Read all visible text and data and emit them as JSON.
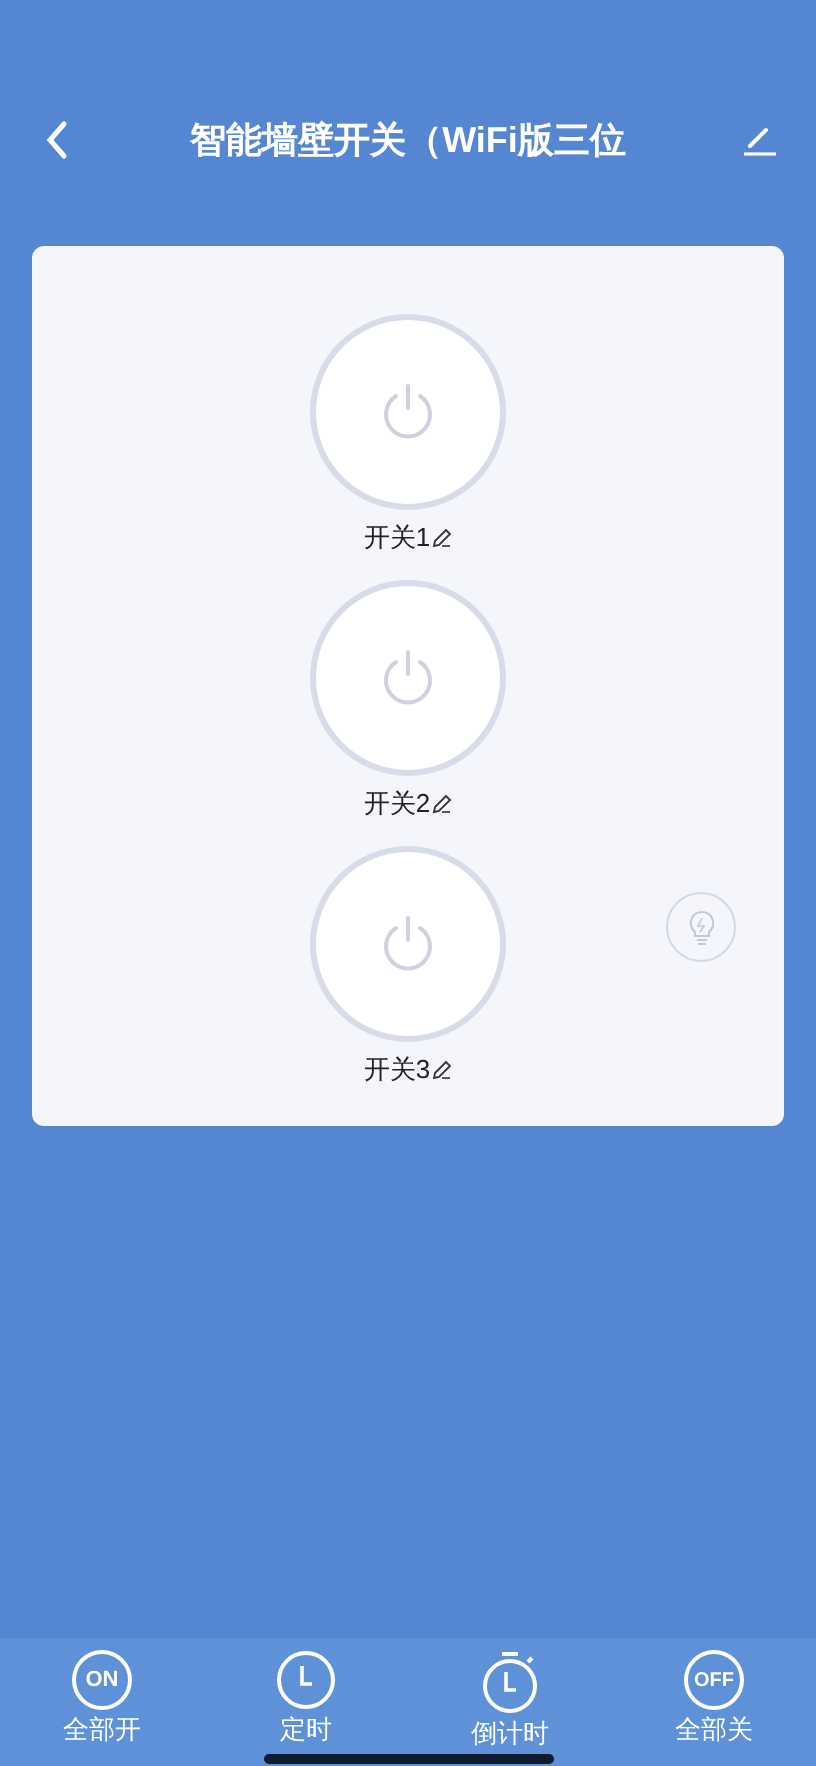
{
  "header": {
    "title": "智能墙壁开关（WiFi版三位"
  },
  "switches": [
    {
      "label": "开关1",
      "on": false
    },
    {
      "label": "开关2",
      "on": false
    },
    {
      "label": "开关3",
      "on": false
    }
  ],
  "toolbar": [
    {
      "kind": "on",
      "icon_text": "ON",
      "label": "全部开"
    },
    {
      "kind": "timer",
      "label": "定时"
    },
    {
      "kind": "countdown",
      "label": "倒计时"
    },
    {
      "kind": "off",
      "icon_text": "OFF",
      "label": "全部关"
    }
  ]
}
